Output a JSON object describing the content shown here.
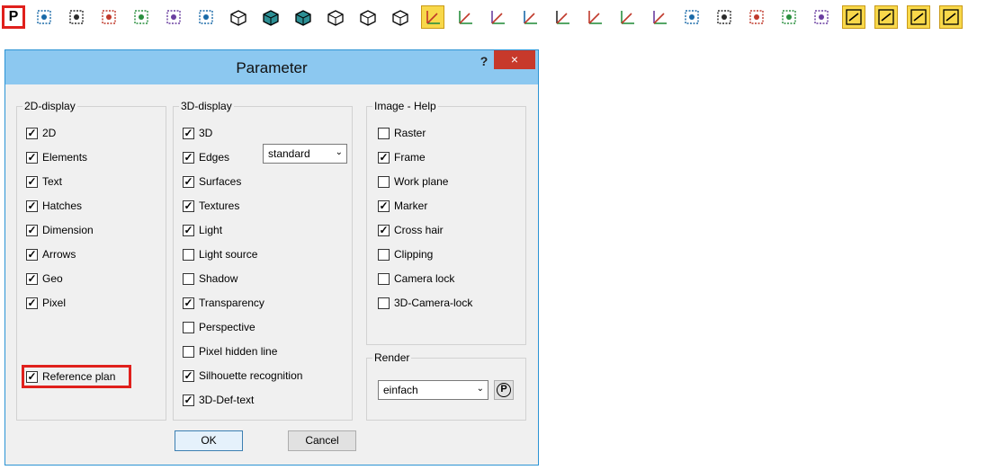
{
  "toolbar": {
    "p_label": "P",
    "icons": [
      "select-area-icon",
      "rotate-left-icon",
      "rotate-right-icon",
      "frame-select-icon",
      "window-icon",
      "zoom-icon",
      "3d-solid-icon",
      "shaded-box-icon",
      "shaded-sphere-icon",
      "wire-box-icon",
      "hidden-line-box-icon",
      "section-box-icon",
      "active-snap-icon",
      "axis-corner-icon",
      "axis-point-icon",
      "axis-up-icon",
      "axis-xy-icon",
      "axis-star-icon",
      "axis-angle-icon",
      "axis-red-icon",
      "grid-block-icon",
      "layer-icon",
      "transform-icon",
      "pen-icon",
      "dot-grid-icon",
      "text-height-icon",
      "arrow-curve-icon",
      "dimension-icon",
      "hatch-icon"
    ],
    "colors": {
      "highlight": "#e0201c",
      "active_bg": "#f8d84a"
    }
  },
  "dialog": {
    "title": "Parameter",
    "help": "?",
    "close": "×",
    "ok_label": "OK",
    "cancel_label": "Cancel"
  },
  "display2d": {
    "legend": "2D-display",
    "items": [
      {
        "label": "2D",
        "checked": true
      },
      {
        "label": "Elements",
        "checked": true
      },
      {
        "label": "Text",
        "checked": true
      },
      {
        "label": "Hatches",
        "checked": true
      },
      {
        "label": "Dimension",
        "checked": true
      },
      {
        "label": "Arrows",
        "checked": true
      },
      {
        "label": "Geo",
        "checked": true
      },
      {
        "label": "Pixel",
        "checked": true
      }
    ],
    "reference_plan": {
      "label": "Reference plan",
      "checked": true
    }
  },
  "display3d": {
    "legend": "3D-display",
    "edges_mode": "standard",
    "items": [
      {
        "label": "3D",
        "checked": true
      },
      {
        "label": "Edges",
        "checked": true
      },
      {
        "label": "Surfaces",
        "checked": true
      },
      {
        "label": "Textures",
        "checked": true
      },
      {
        "label": "Light",
        "checked": true
      },
      {
        "label": "Light source",
        "checked": false
      },
      {
        "label": "Shadow",
        "checked": false
      },
      {
        "label": "Transparency",
        "checked": true
      },
      {
        "label": "Perspective",
        "checked": false
      },
      {
        "label": "Pixel hidden line",
        "checked": false
      },
      {
        "label": "Silhouette recognition",
        "checked": true
      },
      {
        "label": "3D-Def-text",
        "checked": true
      }
    ]
  },
  "imagehelp": {
    "legend": "Image - Help",
    "items": [
      {
        "label": "Raster",
        "checked": false
      },
      {
        "label": "Frame",
        "checked": true
      },
      {
        "label": "Work plane",
        "checked": false
      },
      {
        "label": "Marker",
        "checked": true
      },
      {
        "label": "Cross hair",
        "checked": true
      },
      {
        "label": "Clipping",
        "checked": false
      },
      {
        "label": "Camera lock",
        "checked": false
      },
      {
        "label": "3D-Camera-lock",
        "checked": false
      }
    ]
  },
  "render": {
    "legend": "Render",
    "mode": "einfach",
    "p_button": "P"
  }
}
